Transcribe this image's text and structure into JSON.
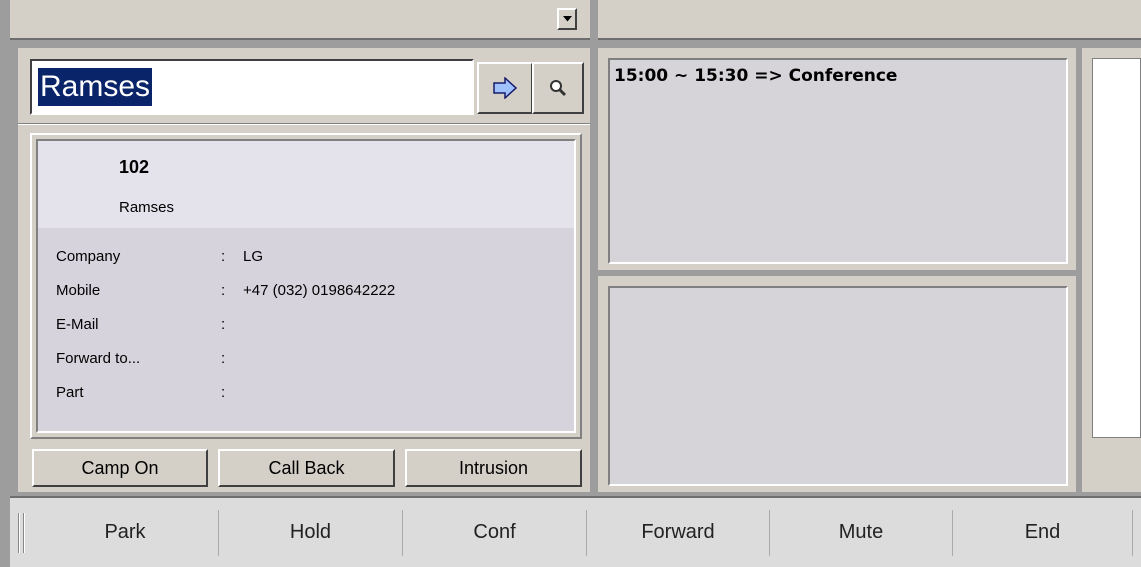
{
  "search": {
    "value": "Ramses"
  },
  "contact": {
    "extension": "102",
    "name": "Ramses",
    "fields": [
      {
        "label": "Company",
        "value": "LG"
      },
      {
        "label": "Mobile",
        "value": "+47 (032) 0198642222"
      },
      {
        "label": "E-Mail",
        "value": ""
      },
      {
        "label": "Forward to...",
        "value": ""
      },
      {
        "label": "Part",
        "value": ""
      }
    ],
    "separator": ":"
  },
  "actions": {
    "camp_on": "Camp On",
    "call_back": "Call Back",
    "intrusion": "Intrusion"
  },
  "schedule": {
    "entry": "15:00 ~ 15:30 => Conference"
  },
  "toolbar": {
    "park": "Park",
    "hold": "Hold",
    "conf": "Conf",
    "forward": "Forward",
    "mute": "Mute",
    "end": "End"
  },
  "icons": {
    "go": "arrow-right-icon",
    "search": "magnifier-icon",
    "dropdown": "chevron-down-icon"
  },
  "colors": {
    "selection": "#0a246a",
    "panel": "#d4d0c8",
    "arrow": "#9fc2ff"
  }
}
